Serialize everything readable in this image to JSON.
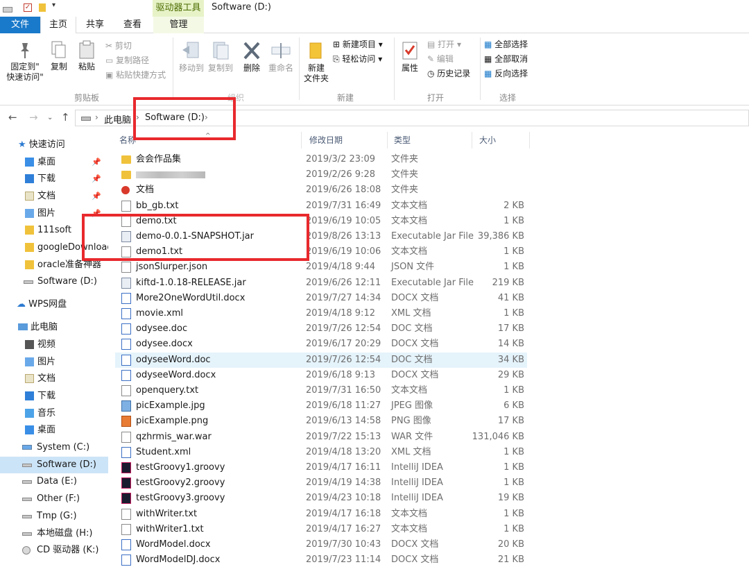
{
  "titlebar": {
    "tools_context": "驱动器工具",
    "window_title": "Software (D:)"
  },
  "tabs": {
    "file": "文件",
    "home": "主页",
    "share": "共享",
    "view": "查看",
    "manage": "管理"
  },
  "ribbon": {
    "pin_quick": "固定到\"\n快速访问\"",
    "copy": "复制",
    "paste": "粘贴",
    "cut": "剪切",
    "copy_path": "复制路径",
    "paste_shortcut": "粘贴快捷方式",
    "clipboard_group": "剪贴板",
    "move_to": "移动到",
    "copy_to": "复制到",
    "delete": "删除",
    "rename": "重命名",
    "organize_group": "组织",
    "new_folder": "新建\n文件夹",
    "new_item": "新建项目",
    "easy_access": "轻松访问",
    "new_group": "新建",
    "properties": "属性",
    "open": "打开",
    "edit": "编辑",
    "history": "历史记录",
    "open_group": "打开",
    "select_all": "全部选择",
    "select_none": "全部取消",
    "invert_selection": "反向选择",
    "select_group": "选择"
  },
  "address": {
    "this_pc": "此电脑",
    "current": "Software (D:)"
  },
  "sidebar": {
    "items": [
      {
        "label": "快速访问",
        "icon": "star-icon"
      },
      {
        "label": "桌面",
        "icon": "desktop-folder-icon"
      },
      {
        "label": "下载",
        "icon": "download-folder-icon"
      },
      {
        "label": "文档",
        "icon": "documents-folder-icon"
      },
      {
        "label": "图片",
        "icon": "pictures-folder-icon"
      },
      {
        "label": "111soft",
        "icon": "folder-icon"
      },
      {
        "label": "googleDownload",
        "icon": "folder-icon"
      },
      {
        "label": "oracle准备神器",
        "icon": "folder-icon"
      },
      {
        "label": "Software (D:)",
        "icon": "drive-icon"
      },
      {
        "label": "WPS网盘",
        "icon": "cloud-icon"
      },
      {
        "label": "此电脑",
        "icon": "computer-icon"
      },
      {
        "label": "视频",
        "icon": "videos-folder-icon"
      },
      {
        "label": "图片",
        "icon": "pictures-folder-icon"
      },
      {
        "label": "文档",
        "icon": "documents-folder-icon"
      },
      {
        "label": "下载",
        "icon": "download-folder-icon"
      },
      {
        "label": "音乐",
        "icon": "music-folder-icon"
      },
      {
        "label": "桌面",
        "icon": "desktop-folder-icon"
      },
      {
        "label": "System (C:)",
        "icon": "system-drive-icon"
      },
      {
        "label": "Software (D:)",
        "icon": "drive-icon"
      },
      {
        "label": "Data (E:)",
        "icon": "drive-icon"
      },
      {
        "label": "Other (F:)",
        "icon": "drive-icon"
      },
      {
        "label": "Tmp (G:)",
        "icon": "drive-icon"
      },
      {
        "label": "本地磁盘 (H:)",
        "icon": "drive-icon"
      },
      {
        "label": "CD 驱动器 (K:)",
        "icon": "cd-drive-icon"
      }
    ]
  },
  "columns": {
    "name": "名称",
    "date": "修改日期",
    "type": "类型",
    "size": "大小"
  },
  "files": [
    {
      "name": "会会作品集",
      "date": "2019/3/2 23:09",
      "type": "文件夹",
      "size": "",
      "icon": "folder-icon"
    },
    {
      "name": "",
      "date": "2019/2/26 9:28",
      "type": "文件夹",
      "size": "",
      "icon": "folder-icon"
    },
    {
      "name": "文档",
      "date": "2019/6/26 18:08",
      "type": "文件夹",
      "size": "",
      "icon": "special-folder-icon"
    },
    {
      "name": "bb_gb.txt",
      "date": "2019/7/31 16:49",
      "type": "文本文档",
      "size": "2 KB",
      "icon": "text-file-icon"
    },
    {
      "name": "demo.txt",
      "date": "2019/6/19 10:05",
      "type": "文本文档",
      "size": "1 KB",
      "icon": "text-file-icon"
    },
    {
      "name": "demo-0.0.1-SNAPSHOT.jar",
      "date": "2019/8/26 13:13",
      "type": "Executable Jar File",
      "size": "39,386 KB",
      "icon": "jar-file-icon"
    },
    {
      "name": "demo1.txt",
      "date": "2019/6/19 10:06",
      "type": "文本文档",
      "size": "1 KB",
      "icon": "text-file-icon"
    },
    {
      "name": "jsonSlurper.json",
      "date": "2019/4/18 9:44",
      "type": "JSON 文件",
      "size": "1 KB",
      "icon": "generic-file-icon"
    },
    {
      "name": "kiftd-1.0.18-RELEASE.jar",
      "date": "2019/6/26 12:11",
      "type": "Executable Jar File",
      "size": "219 KB",
      "icon": "jar-file-icon"
    },
    {
      "name": "More2OneWordUtil.docx",
      "date": "2019/7/27 14:34",
      "type": "DOCX 文档",
      "size": "41 KB",
      "icon": "docx-file-icon"
    },
    {
      "name": "movie.xml",
      "date": "2019/4/18 9:12",
      "type": "XML 文档",
      "size": "1 KB",
      "icon": "xml-file-icon"
    },
    {
      "name": "odysee.doc",
      "date": "2019/7/26 12:54",
      "type": "DOC 文档",
      "size": "17 KB",
      "icon": "doc-file-icon"
    },
    {
      "name": "odysee.docx",
      "date": "2019/6/17 20:29",
      "type": "DOCX 文档",
      "size": "14 KB",
      "icon": "docx-file-icon"
    },
    {
      "name": "odyseeWord.doc",
      "date": "2019/7/26 12:54",
      "type": "DOC 文档",
      "size": "34 KB",
      "icon": "doc-file-icon"
    },
    {
      "name": "odyseeWord.docx",
      "date": "2019/6/18 9:13",
      "type": "DOCX 文档",
      "size": "29 KB",
      "icon": "docx-file-icon"
    },
    {
      "name": "openquery.txt",
      "date": "2019/7/31 16:50",
      "type": "文本文档",
      "size": "1 KB",
      "icon": "text-file-icon"
    },
    {
      "name": "picExample.jpg",
      "date": "2019/6/18 11:27",
      "type": "JPEG 图像",
      "size": "6 KB",
      "icon": "image-file-icon"
    },
    {
      "name": "picExample.png",
      "date": "2019/6/13 14:58",
      "type": "PNG 图像",
      "size": "17 KB",
      "icon": "png-file-icon"
    },
    {
      "name": "qzhrmis_war.war",
      "date": "2019/7/22 15:13",
      "type": "WAR 文件",
      "size": "131,046 KB",
      "icon": "generic-file-icon"
    },
    {
      "name": "Student.xml",
      "date": "2019/4/18 13:20",
      "type": "XML 文档",
      "size": "1 KB",
      "icon": "xml-file-icon"
    },
    {
      "name": "testGroovy1.groovy",
      "date": "2019/4/17 16:11",
      "type": "IntelliJ IDEA",
      "size": "1 KB",
      "icon": "intellij-file-icon"
    },
    {
      "name": "testGroovy2.groovy",
      "date": "2019/4/19 14:38",
      "type": "IntelliJ IDEA",
      "size": "1 KB",
      "icon": "intellij-file-icon"
    },
    {
      "name": "testGroovy3.groovy",
      "date": "2019/4/23 10:18",
      "type": "IntelliJ IDEA",
      "size": "19 KB",
      "icon": "intellij-file-icon"
    },
    {
      "name": "withWriter.txt",
      "date": "2019/4/17 16:18",
      "type": "文本文档",
      "size": "1 KB",
      "icon": "text-file-icon"
    },
    {
      "name": "withWriter1.txt",
      "date": "2019/4/17 16:27",
      "type": "文本文档",
      "size": "1 KB",
      "icon": "text-file-icon"
    },
    {
      "name": "WordModel.docx",
      "date": "2019/7/30 10:43",
      "type": "DOCX 文档",
      "size": "20 KB",
      "icon": "docx-file-icon"
    },
    {
      "name": "WordModelDJ.docx",
      "date": "2019/7/23 11:14",
      "type": "DOCX 文档",
      "size": "21 KB",
      "icon": "docx-file-icon"
    }
  ],
  "colors": {
    "file_tab": "#1979ca",
    "selection": "#cce4f7",
    "hover_row": "#e5f3fb",
    "annotation_red": "#e8292d",
    "folder_yellow": "#f0c23b"
  }
}
